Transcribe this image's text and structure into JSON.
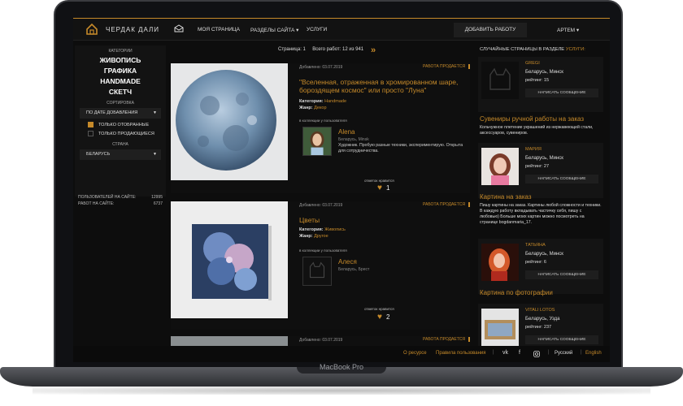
{
  "device": {
    "label": "MacBook Pro"
  },
  "header": {
    "logo_text": "ЧЕРДАК ДАЛИ",
    "nav": [
      "МОЯ СТРАНИЦА",
      "РАЗДЕЛЫ САЙТА ▾",
      "УСЛУГИ"
    ],
    "add_button": "ДОБАВИТЬ РАБОТУ",
    "user_menu": "АРТЕМ ▾"
  },
  "sidebar": {
    "categories_heading": "КАТЕГОРИИ",
    "categories": [
      "ЖИВОПИСЬ",
      "ГРАФИКА",
      "HANDMADE",
      "СКЕТЧ"
    ],
    "sort_heading": "СОРТИРОВКА",
    "sort_value": "ПО ДАТЕ ДОБАВЛЕНИЯ",
    "check_selected": "ТОЛЬКО ОТОБРАННЫЕ",
    "check_for_sale": "ТОЛЬКО ПРОДАЮЩИЕСЯ",
    "country_heading": "СТРАНА",
    "country_value": "БЕЛАРУСЬ",
    "stats": [
      {
        "label": "ПОЛЬЗОВАТЕЛЕЙ НА САЙТЕ:",
        "value": "12995"
      },
      {
        "label": "РАБОТ НА САЙТЕ:",
        "value": "6737"
      }
    ]
  },
  "pager": {
    "page": "Страница: 1",
    "total": "Всего работ: 12 из 941"
  },
  "works": [
    {
      "added": "Добавлено: 03.07.2019",
      "sale": "РАБОТА ПРОДАЕТСЯ",
      "title": "\"Вселенная, отраженная в хромированном шаре, бороздящем космос\" или просто \"Луна\"",
      "category_key": "Категория:",
      "category": "Handmade",
      "genre_key": "Жанр:",
      "genre": "Декор",
      "collection_label": "в коллекции у пользователя",
      "collector_name": "Alena",
      "collector_loc": "Беларусь, Minsk",
      "collector_desc": "Художник. Пробую разные техники, экспериментирую. Открыта для сотрудничества.",
      "likes_label": "отметок нравится",
      "likes": "1"
    },
    {
      "added": "Добавлено: 03.07.2019",
      "sale": "РАБОТА ПРОДАЕТСЯ",
      "title": "Цветы",
      "category_key": "Категория:",
      "category": "Живопись",
      "genre_key": "Жанр:",
      "genre": "Другое",
      "collection_label": "в коллекции у пользователя",
      "collector_name": "Алеся",
      "collector_loc": "Беларусь, Брест",
      "collector_desc": "",
      "likes_label": "отметок нравится",
      "likes": "2"
    },
    {
      "added": "Добавлено: 03.07.2019",
      "sale": "РАБОТА ПРОДАЕТСЯ"
    }
  ],
  "right": {
    "heading_prefix": "СЛУЧАЙНЫЕ СТРАНИЦЫ В РАЗДЕЛЕ",
    "heading_link": "УСЛУГИ:",
    "users": [
      {
        "name": "GREGI",
        "loc": "Беларусь, Минск",
        "rating_label": "рейтинг:",
        "rating": "15",
        "msg": "НАПИСАТЬ СООБЩЕНИЕ",
        "promo_title": "Сувениры ручной работы на заказ",
        "promo_text": "Кольчужное плетение украшений из нержавеющей стали, аксессуаров, сувениров."
      },
      {
        "name": "МАРИЯ",
        "loc": "Беларусь, Минск",
        "rating_label": "рейтинг:",
        "rating": "27",
        "msg": "НАПИСАТЬ СООБЩЕНИЕ",
        "promo_title": "Картина на заказ",
        "promo_text": "Пишу картины на заказ. Картины любой сложности и техники. В каждую работу вкладывать частичку себя, пишу с любовью) Больше моих картин можно посмотреть на странице bogdanmaria_17."
      },
      {
        "name": "ТАТЬЯНА",
        "loc": "Беларусь, Минск",
        "rating_label": "рейтинг:",
        "rating": "6",
        "msg": "НАПИСАТЬ СООБЩЕНИЕ",
        "promo_title": "Картина по фотографии",
        "promo_text": ""
      },
      {
        "name": "VITALI LOTOS",
        "loc": "Беларусь, Узда",
        "rating_label": "рейтинг:",
        "rating": "237",
        "msg": "НАПИСАТЬ СООБЩЕНИЕ",
        "promo_title": "",
        "promo_text": ""
      }
    ]
  },
  "footer": {
    "about": "О ресурсе",
    "rules": "Правила пользования",
    "social": [
      "vk",
      "f",
      "ig"
    ],
    "lang_ru": "Русский",
    "lang_en": "English"
  },
  "colors": {
    "accent": "#c68a2a",
    "bg": "#0d0d0d",
    "panel": "#141414"
  }
}
